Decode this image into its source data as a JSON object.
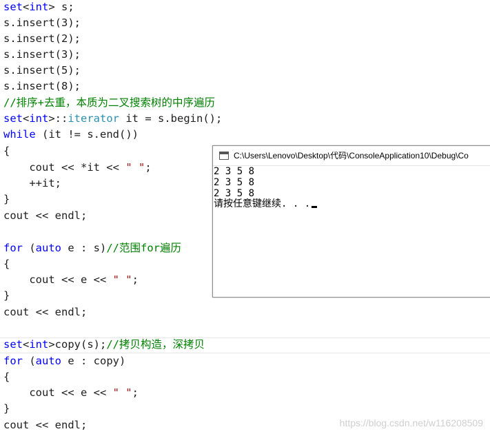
{
  "code": {
    "line1": {
      "t1": "set",
      "t2": "<",
      "t3": "int",
      "t4": "> s;"
    },
    "line2": "s.insert(3);",
    "line3": "s.insert(2);",
    "line4": "s.insert(3);",
    "line5": "s.insert(5);",
    "line6": "s.insert(8);",
    "line7": "//排序+去重，本质为二叉搜索树的中序遍历",
    "line8": {
      "t1": "set",
      "t2": "<",
      "t3": "int",
      "t4": ">::",
      "t5": "iterator",
      "t6": " it = s.begin();"
    },
    "line9": {
      "t1": "while",
      "t2": " (it != s.end())"
    },
    "line10": "{",
    "line11": {
      "t1": "    cout << *it << ",
      "t2": "\" \"",
      "t3": ";"
    },
    "line12": "    ++it;",
    "line13": "}",
    "line14": "cout << endl;",
    "line15": {
      "t1": "for",
      "t2": " (",
      "t3": "auto",
      "t4": " e : s)",
      "t5": "//范围for遍历"
    },
    "line16": "{",
    "line17": {
      "t1": "    cout << e << ",
      "t2": "\" \"",
      "t3": ";"
    },
    "line18": "}",
    "line19": "cout << endl;",
    "line20": {
      "t1": "set",
      "t2": "<",
      "t3": "int",
      "t4": ">copy(s);",
      "t5": "//拷贝构造，深拷贝"
    },
    "line21": {
      "t1": "for",
      "t2": " (",
      "t3": "auto",
      "t4": " e : copy)"
    },
    "line22": "{",
    "line23": {
      "t1": "    cout << e << ",
      "t2": "\" \"",
      "t3": ";"
    },
    "line24": "}",
    "line25": "cout << endl;"
  },
  "console": {
    "title": "C:\\Users\\Lenovo\\Desktop\\代码\\ConsoleApplication10\\Debug\\Co",
    "output": [
      "2 3 5 8",
      "2 3 5 8",
      "2 3 5 8",
      "请按任意键继续. . ."
    ]
  },
  "watermark": "https://blog.csdn.net/w116208509"
}
